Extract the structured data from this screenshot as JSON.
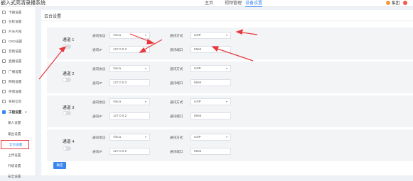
{
  "header": {
    "app_title": "嵌入式高清录播系统",
    "nav": [
      "主页",
      "视频管理",
      "设备设置"
    ],
    "user_name": "集团"
  },
  "sidebar": {
    "items": [
      {
        "label": "卡箱设置"
      },
      {
        "label": "台标设置"
      },
      {
        "label": "片头片尾"
      },
      {
        "label": "OSD设置"
      },
      {
        "label": "音频设置"
      },
      {
        "label": "直播设置"
      },
      {
        "label": "广播设置"
      },
      {
        "label": "网络设置"
      },
      {
        "label": "存储设置"
      },
      {
        "label": "系统信息"
      },
      {
        "label": "工程设置",
        "group": true
      },
      {
        "label": "输入设置"
      },
      {
        "label": "输出设置"
      },
      {
        "label": "云台设置",
        "active": true
      },
      {
        "label": "上传设置"
      },
      {
        "label": "升级设置"
      },
      {
        "label": "安全设置"
      }
    ]
  },
  "panel": {
    "title": "云台设置",
    "labels": {
      "protocol": "通讯协议",
      "mode": "通讯方式",
      "ip": "通讯IP",
      "port": "通讯端口"
    },
    "channels": [
      {
        "name": "通道 1",
        "protocol": "Visca",
        "mode": "UDP",
        "ip": "127.0.0.2",
        "port": "5656"
      },
      {
        "name": "通道 2",
        "protocol": "Visca",
        "mode": "UDP",
        "ip": "127.0.0.2",
        "port": "5656"
      },
      {
        "name": "通道 3",
        "protocol": "Visca",
        "mode": "UDP",
        "ip": "127.0.0.2",
        "port": "5656"
      },
      {
        "name": "通道 4",
        "protocol": "Visca",
        "mode": "UDP",
        "ip": "127.0.0.2",
        "port": "5656"
      }
    ],
    "confirm_label": "确定"
  },
  "colors": {
    "accent": "#3a86f0",
    "annotation": "#e8383d"
  }
}
